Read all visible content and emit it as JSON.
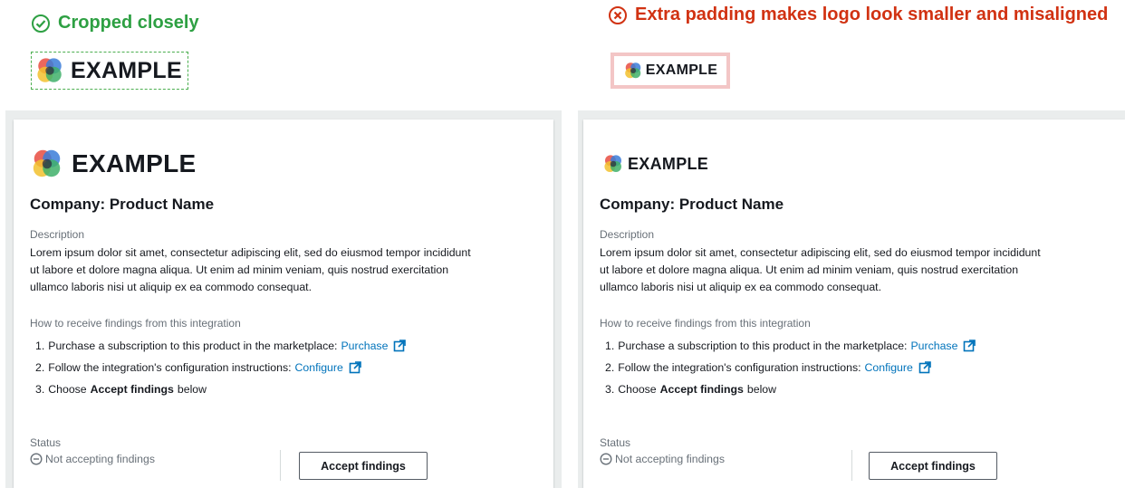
{
  "good": {
    "verdict": "Cropped closely",
    "verdict_color": "#2ea043",
    "logo_word": "EXAMPLE"
  },
  "bad": {
    "verdict": "Extra padding makes logo look smaller and misaligned",
    "verdict_color": "#d13212",
    "logo_word": "EXAMPLE"
  },
  "card": {
    "logo_word": "EXAMPLE",
    "title": "Company: Product Name",
    "description_label": "Description",
    "description_lines": [
      "Lorem ipsum dolor sit amet, consectetur adipiscing elit, sed do eiusmod tempor incididunt",
      "ut labore et dolore magna aliqua. Ut enim ad minim veniam, quis nostrud exercitation",
      "ullamco laboris nisi ut aliquip ex ea commodo consequat."
    ],
    "how_label": "How to receive findings from this integration",
    "steps": [
      {
        "num": "1.",
        "text": "Purchase a subscription to this product in the marketplace:",
        "link": "Purchase"
      },
      {
        "num": "2.",
        "text": "Follow the integration's configuration instructions:",
        "link": "Configure"
      },
      {
        "num": "3.",
        "pre": "Choose",
        "bold": "Accept findings",
        "post": "below"
      }
    ],
    "status_label": "Status",
    "status_value": "Not accepting findings",
    "button_label": "Accept findings"
  },
  "colors": {
    "link": "#0073bb",
    "background_frame": "#eaeded",
    "bad_logo_border": "#f3c6c6",
    "good_logo_border": "#4caf50"
  },
  "icons": [
    "check-circle-icon",
    "x-circle-icon",
    "logo-mark-icon",
    "external-link-icon",
    "minus-circle-icon"
  ]
}
